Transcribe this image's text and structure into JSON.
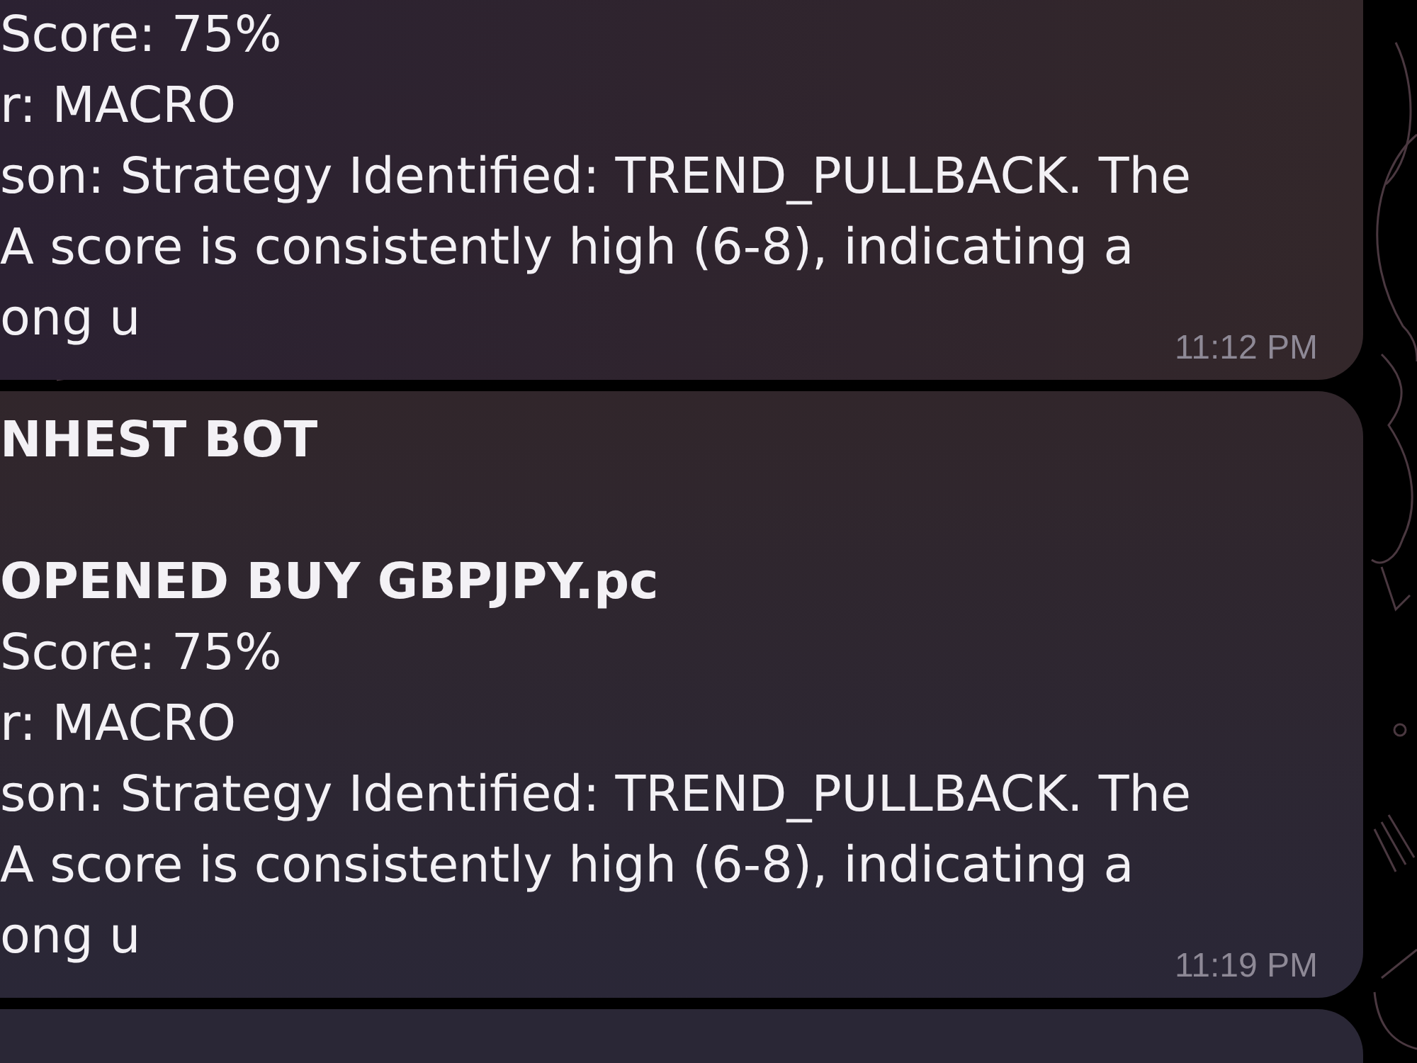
{
  "messages": [
    {
      "lines": [
        {
          "kind": "body",
          "text": "Score: 75%"
        },
        {
          "kind": "body",
          "text": "r: MACRO"
        },
        {
          "kind": "body",
          "text": "son: Strategy Identified: TREND_PULLBACK. The"
        },
        {
          "kind": "body",
          "text": "A score is consistently high (6-8), indicating a"
        },
        {
          "kind": "body",
          "text": "ong u"
        }
      ],
      "time": "11:12 PM"
    },
    {
      "lines": [
        {
          "kind": "sender",
          "text": "NHEST BOT"
        },
        {
          "kind": "heading",
          "text": "OPENED BUY GBPJPY.pc"
        },
        {
          "kind": "body",
          "text": "Score: 75%"
        },
        {
          "kind": "body",
          "text": "r: MACRO"
        },
        {
          "kind": "body",
          "text": "son: Strategy Identified: TREND_PULLBACK. The"
        },
        {
          "kind": "body",
          "text": "A score is consistently high (6-8), indicating a"
        },
        {
          "kind": "body",
          "text": "ong u"
        }
      ],
      "time": "11:19 PM"
    }
  ]
}
